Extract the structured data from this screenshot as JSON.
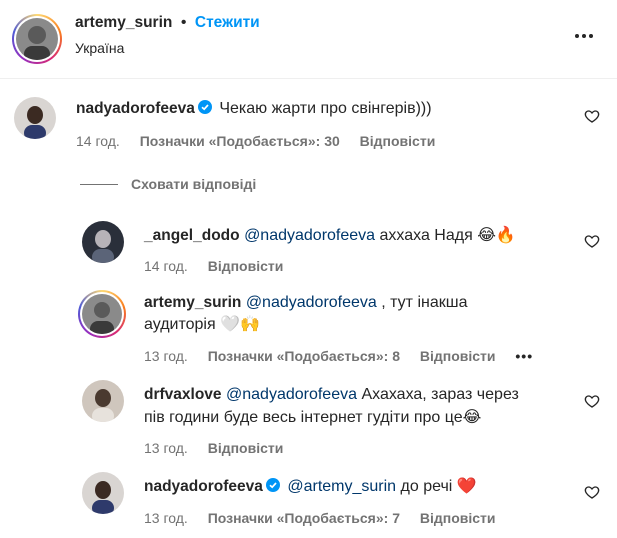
{
  "header": {
    "username": "artemy_surin",
    "separator": "•",
    "follow_label": "Стежити",
    "location": "Україна",
    "more_icon": "more-horizontal-icon"
  },
  "main_comment": {
    "username": "nadyadorofeeva",
    "text": "Чекаю жарти про свінгерів)))",
    "time": "14 год.",
    "likes": "Позначки «Подобається»: 30",
    "reply": "Відповісти"
  },
  "hide_replies": "Сховати відповіді",
  "replies": [
    {
      "username": "_angel_dodo",
      "mention": "@nadyadorofeeva",
      "text": "аххаха Надя 😂🔥",
      "time": "14 год.",
      "reply": "Відповісти"
    },
    {
      "username": "artemy_surin",
      "mention": "@nadyadorofeeva",
      "text_line1": ", тут інакша",
      "text_line2": "аудиторія 🤍🙌",
      "time": "13 год.",
      "likes": "Позначки «Подобається»: 8",
      "reply": "Відповісти",
      "more": "•••"
    },
    {
      "username": "drfvaxlove",
      "mention": "@nadyadorofeeva",
      "text_line1": "Ахахаха, зараз через",
      "text_line2": "пів години буде весь інтернет гудіти про це😂",
      "time": "13 год.",
      "reply": "Відповісти"
    },
    {
      "username": "nadyadorofeeva",
      "mention": "@artemy_surin",
      "text": "до речі ❤️",
      "time": "13 год.",
      "likes": "Позначки «Подобається»: 7",
      "reply": "Відповісти"
    }
  ],
  "icons": {
    "heart": "heart-outline-icon",
    "verified": "verified-badge-icon"
  },
  "colors": {
    "link_blue": "#0095f6",
    "mention_blue": "#00376b",
    "verified_blue": "#0095f6",
    "meta_gray": "#737373"
  }
}
